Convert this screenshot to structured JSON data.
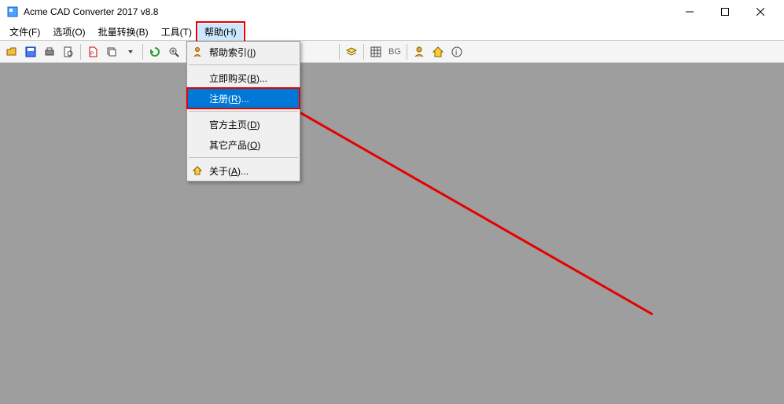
{
  "titlebar": {
    "title": "Acme CAD Converter 2017 v8.8"
  },
  "menubar": {
    "items": [
      {
        "label": "文件(F)"
      },
      {
        "label": "选项(O)"
      },
      {
        "label": "批量转换(B)"
      },
      {
        "label": "工具(T)"
      },
      {
        "label": "帮助(H)"
      }
    ]
  },
  "toolbar": {
    "bg_label": "BG"
  },
  "help_menu": {
    "items": [
      {
        "label_pre": "帮助索引(",
        "hotkey": "I",
        "label_post": ")",
        "icon": "person"
      },
      {
        "sep": true
      },
      {
        "label_pre": "立即购买(",
        "hotkey": "B",
        "label_post": ")..."
      },
      {
        "label_pre": "注册(",
        "hotkey": "R",
        "label_post": ")...",
        "selected": true,
        "highlighted": true
      },
      {
        "sep": true
      },
      {
        "label_pre": "官方主页(",
        "hotkey": "D",
        "label_post": ")"
      },
      {
        "label_pre": "其它产品(",
        "hotkey": "O",
        "label_post": ")"
      },
      {
        "sep": true
      },
      {
        "label_pre": "关于(",
        "hotkey": "A",
        "label_post": ")...",
        "icon": "home"
      }
    ]
  }
}
